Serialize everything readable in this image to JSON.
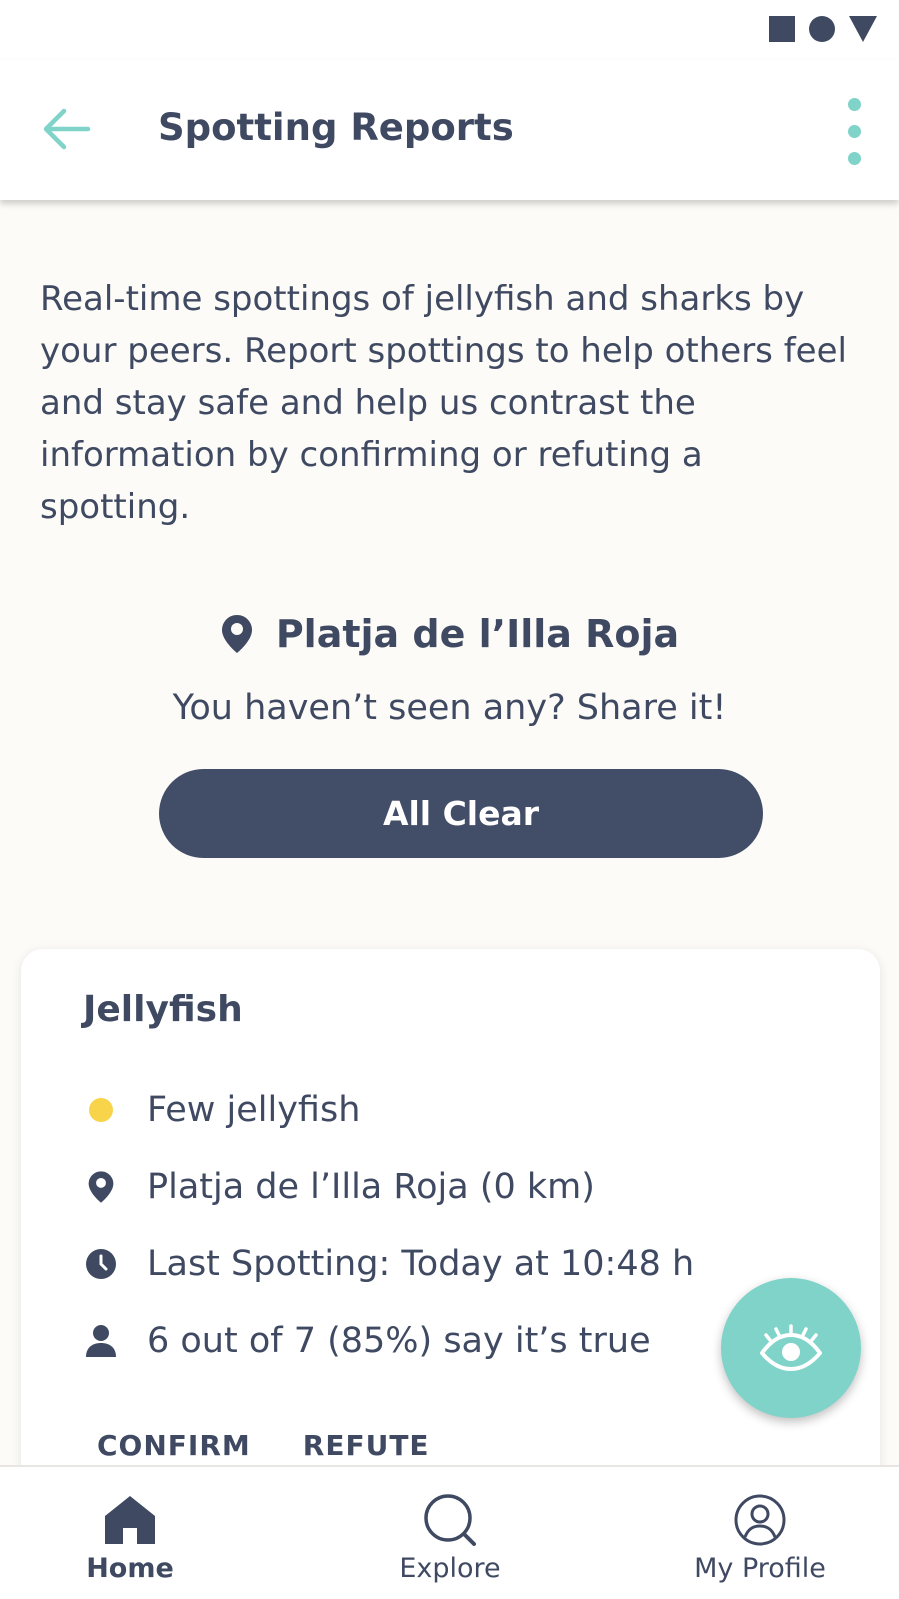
{
  "app_bar": {
    "title": "Spotting Reports",
    "back_icon": "arrow-left-icon",
    "menu_icon": "more-vertical-icon"
  },
  "intro_text": "Real-time spottings of jellyfish and sharks by your peers. Report spottings to help others feel and stay safe and help us contrast the information by confirming or refuting a spotting.",
  "location": {
    "name": "Platja de l’Illa Roja",
    "icon": "map-pin-icon"
  },
  "share_prompt": "You haven’t seen any? Share it!",
  "all_clear_label": "All Clear",
  "card": {
    "title": "Jellyfish",
    "level": "Few jellyfish",
    "level_color": "#f7d44a",
    "place": "Platja de l’Illa Roja (0 km)",
    "last_spotting": "Last Spotting: Today at 10:48 h",
    "confirmations": "6 out of 7 (85%) say it’s true",
    "confirm_label": "CONFIRM",
    "refute_label": "REFUTE"
  },
  "fab_icon": "eye-icon",
  "bottom_nav": {
    "items": [
      {
        "label": "Home",
        "icon": "home-icon",
        "active": true
      },
      {
        "label": "Explore",
        "icon": "search-icon",
        "active": false
      },
      {
        "label": "My Profile",
        "icon": "profile-icon",
        "active": false
      }
    ]
  },
  "colors": {
    "primary": "#424d68",
    "accent": "#7fd3c8",
    "background": "#fcfbf7"
  }
}
